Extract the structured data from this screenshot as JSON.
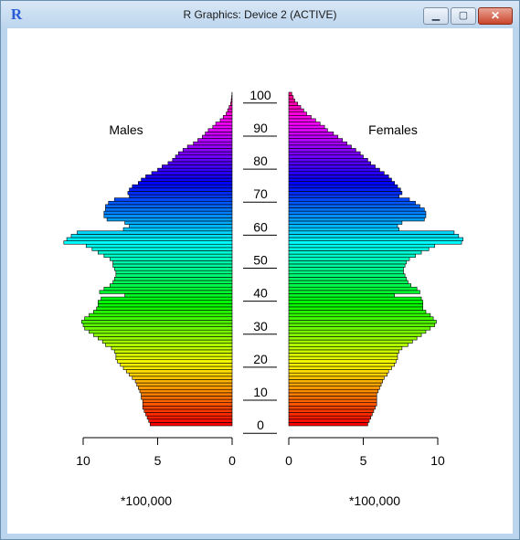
{
  "window": {
    "title": "R Graphics: Device 2 (ACTIVE)",
    "app_icon": "R",
    "controls": {
      "minimize_icon": "minimize-icon",
      "maximize_icon": "maximize-icon",
      "close_icon": "close-icon"
    }
  },
  "chart_data": {
    "type": "bar",
    "orientation": "horizontal-pyramid",
    "title": "",
    "left_panel_label": "Males",
    "right_panel_label": "Females",
    "x_unit_label_left": "*100,000",
    "x_unit_label_right": "*100,000",
    "x_ticks": [
      "10",
      "5",
      "0"
    ],
    "x_ticks_right": [
      "0",
      "5",
      "10"
    ],
    "xlim": [
      0,
      11.5
    ],
    "age_ticks": [
      "0",
      "10",
      "20",
      "30",
      "40",
      "50",
      "60",
      "70",
      "80",
      "90",
      "100"
    ],
    "ages": [
      0,
      1,
      2,
      3,
      4,
      5,
      6,
      7,
      8,
      9,
      10,
      11,
      12,
      13,
      14,
      15,
      16,
      17,
      18,
      19,
      20,
      21,
      22,
      23,
      24,
      25,
      26,
      27,
      28,
      29,
      30,
      31,
      32,
      33,
      34,
      35,
      36,
      37,
      38,
      39,
      40,
      41,
      42,
      43,
      44,
      45,
      46,
      47,
      48,
      49,
      50,
      51,
      52,
      53,
      54,
      55,
      56,
      57,
      58,
      59,
      60,
      61,
      62,
      63,
      64,
      65,
      66,
      67,
      68,
      69,
      70,
      71,
      72,
      73,
      74,
      75,
      76,
      77,
      78,
      79,
      80,
      81,
      82,
      83,
      84,
      85,
      86,
      87,
      88,
      89,
      90,
      91,
      92,
      93,
      94,
      95,
      96,
      97,
      98,
      99,
      100
    ],
    "colors": "rainbow",
    "series": [
      {
        "name": "Males",
        "values": [
          5.5,
          5.6,
          5.7,
          5.8,
          5.9,
          6.0,
          6.0,
          6.0,
          6.1,
          6.1,
          6.2,
          6.3,
          6.4,
          6.5,
          6.7,
          6.9,
          7.1,
          7.3,
          7.5,
          7.7,
          7.8,
          7.8,
          7.9,
          8.1,
          8.5,
          8.7,
          9.0,
          9.3,
          9.6,
          9.9,
          10.0,
          10.1,
          9.9,
          9.6,
          9.3,
          9.1,
          9.0,
          9.0,
          8.8,
          7.2,
          8.9,
          8.6,
          8.2,
          8.0,
          7.9,
          7.8,
          7.8,
          7.9,
          8.0,
          8.0,
          8.2,
          8.6,
          9.0,
          9.4,
          9.8,
          11.3,
          11.1,
          10.8,
          10.4,
          7.3,
          6.9,
          7.2,
          8.4,
          8.6,
          8.6,
          8.5,
          8.5,
          8.3,
          7.9,
          6.9,
          7.0,
          6.9,
          6.7,
          6.3,
          6.1,
          5.8,
          5.4,
          5.0,
          4.7,
          4.3,
          4.0,
          3.8,
          3.6,
          3.3,
          3.0,
          2.6,
          2.3,
          2.0,
          1.8,
          1.6,
          1.3,
          1.1,
          0.8,
          0.6,
          0.4,
          0.3,
          0.2,
          0.1,
          0.06,
          0.03,
          0.01
        ]
      },
      {
        "name": "Females",
        "values": [
          5.3,
          5.4,
          5.5,
          5.6,
          5.7,
          5.8,
          5.9,
          5.9,
          5.9,
          5.9,
          6.0,
          6.1,
          6.2,
          6.3,
          6.4,
          6.6,
          6.7,
          6.9,
          7.1,
          7.2,
          7.3,
          7.3,
          7.4,
          7.6,
          8.0,
          8.3,
          8.6,
          8.9,
          9.2,
          9.5,
          9.8,
          9.9,
          9.7,
          9.5,
          9.2,
          9.0,
          9.0,
          9.0,
          8.9,
          7.1,
          8.8,
          8.6,
          8.2,
          8.0,
          7.9,
          7.8,
          7.7,
          7.7,
          7.8,
          7.9,
          8.1,
          8.5,
          8.9,
          9.4,
          9.8,
          11.6,
          11.7,
          11.4,
          11.1,
          7.4,
          7.3,
          7.6,
          9.1,
          9.2,
          9.2,
          9.1,
          8.8,
          8.5,
          8.1,
          7.4,
          7.6,
          7.5,
          7.3,
          7.1,
          6.9,
          6.7,
          6.4,
          6.1,
          5.8,
          5.5,
          5.3,
          5.0,
          4.8,
          4.5,
          4.2,
          3.9,
          3.6,
          3.3,
          3.0,
          2.6,
          2.4,
          2.1,
          1.8,
          1.5,
          1.2,
          1.0,
          0.8,
          0.6,
          0.4,
          0.3,
          0.2
        ]
      }
    ]
  }
}
